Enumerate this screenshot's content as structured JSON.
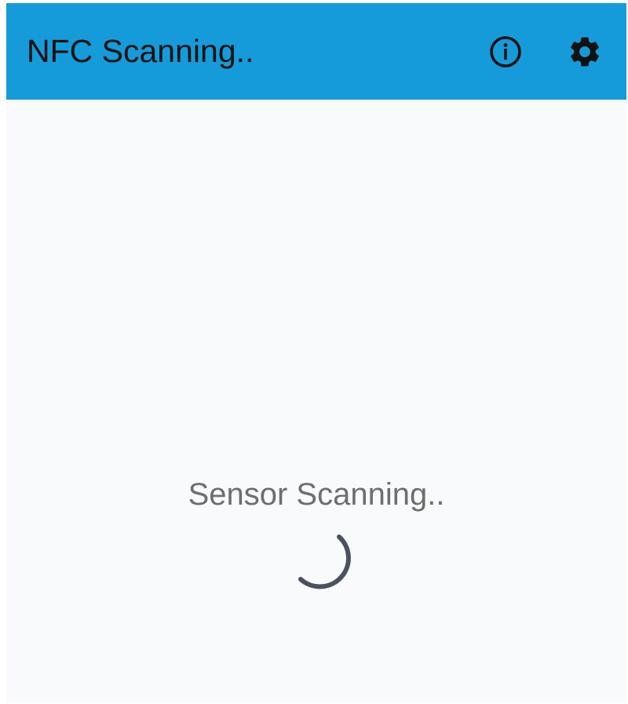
{
  "app_bar": {
    "title": "NFC Scanning..",
    "background_color": "#159bd9",
    "actions": [
      {
        "icon": "info-icon"
      },
      {
        "icon": "gear-icon"
      }
    ]
  },
  "main": {
    "status_text": "Sensor Scanning..",
    "spinner_color": "#4a5160"
  }
}
